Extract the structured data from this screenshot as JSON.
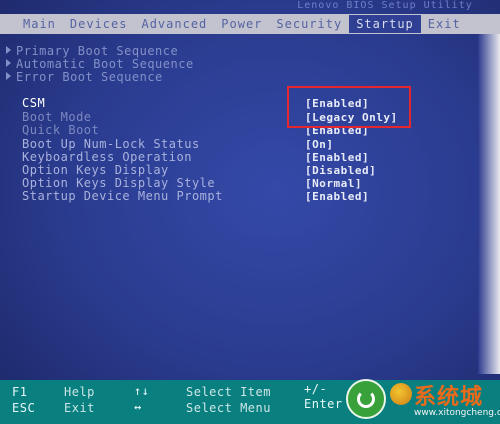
{
  "window": {
    "utility_title": "Lenovo BIOS Setup Utility"
  },
  "tabs": [
    {
      "label": "Main",
      "active": false
    },
    {
      "label": "Devices",
      "active": false
    },
    {
      "label": "Advanced",
      "active": false
    },
    {
      "label": "Power",
      "active": false
    },
    {
      "label": "Security",
      "active": false
    },
    {
      "label": "Startup",
      "active": true
    },
    {
      "label": "Exit",
      "active": false
    }
  ],
  "submenus": [
    {
      "label": "Primary Boot Sequence"
    },
    {
      "label": "Automatic Boot Sequence"
    },
    {
      "label": "Error Boot Sequence"
    }
  ],
  "settings": [
    {
      "label": "CSM",
      "value": "[Enabled]"
    },
    {
      "label": "Boot Mode",
      "value": "[Legacy Only]"
    },
    {
      "label": "Quick Boot",
      "value": "[Enabled]"
    },
    {
      "label": "Boot Up Num-Lock Status",
      "value": "[On]"
    },
    {
      "label": "Keyboardless Operation",
      "value": "[Enabled]"
    },
    {
      "label": "Option Keys Display",
      "value": "[Disabled]"
    },
    {
      "label": "Option Keys Display Style",
      "value": "[Normal]"
    },
    {
      "label": "Startup Device Menu Prompt",
      "value": "[Enabled]"
    }
  ],
  "keybar": {
    "f1": "F1",
    "help": "Help",
    "esc": "ESC",
    "exit": "Exit",
    "select_item": "Select Item",
    "select_menu": "Select Menu",
    "plus_minus": "+/-",
    "enter": "Enter"
  },
  "watermark": {
    "text": "系统城",
    "url": "www.xitongcheng.com"
  },
  "colors": {
    "background": "#2a3b8e",
    "tab_bar": "#c2c3cf",
    "keybar": "#0a7f7f",
    "highlight": "#e5262f"
  }
}
